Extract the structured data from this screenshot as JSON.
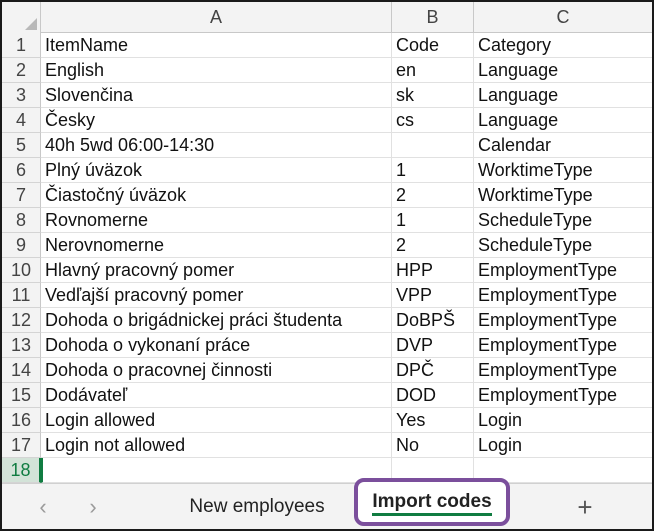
{
  "columns": [
    "A",
    "B",
    "C"
  ],
  "rows": [
    {
      "num": "1",
      "a": "ItemName",
      "b": "Code",
      "c": "Category"
    },
    {
      "num": "2",
      "a": "English",
      "b": "en",
      "c": "Language"
    },
    {
      "num": "3",
      "a": "Slovenčina",
      "b": "sk",
      "c": "Language"
    },
    {
      "num": "4",
      "a": "Česky",
      "b": "cs",
      "c": "Language"
    },
    {
      "num": "5",
      "a": "40h 5wd 06:00-14:30",
      "b": "",
      "c": "Calendar"
    },
    {
      "num": "6",
      "a": "Plný úväzok",
      "b": "1",
      "c": "WorktimeType"
    },
    {
      "num": "7",
      "a": "Čiastočný úväzok",
      "b": "2",
      "c": "WorktimeType"
    },
    {
      "num": "8",
      "a": "Rovnomerne",
      "b": "1",
      "c": "ScheduleType"
    },
    {
      "num": "9",
      "a": "Nerovnomerne",
      "b": "2",
      "c": "ScheduleType"
    },
    {
      "num": "10",
      "a": "Hlavný pracovný pomer",
      "b": "HPP",
      "c": "EmploymentType"
    },
    {
      "num": "11",
      "a": "Vedľajší pracovný pomer",
      "b": "VPP",
      "c": "EmploymentType"
    },
    {
      "num": "12",
      "a": "Dohoda o brigádnickej práci študenta",
      "b": "DoBPŠ",
      "c": "EmploymentType"
    },
    {
      "num": "13",
      "a": "Dohoda o vykonaní práce",
      "b": "DVP",
      "c": "EmploymentType"
    },
    {
      "num": "14",
      "a": "Dohoda o pracovnej činnosti",
      "b": "DPČ",
      "c": "EmploymentType"
    },
    {
      "num": "15",
      "a": "Dodávateľ",
      "b": "DOD",
      "c": "EmploymentType"
    },
    {
      "num": "16",
      "a": "Login allowed",
      "b": "Yes",
      "c": "Login"
    },
    {
      "num": "17",
      "a": "Login not allowed",
      "b": "No",
      "c": "Login"
    },
    {
      "num": "18",
      "a": "",
      "b": "",
      "c": ""
    }
  ],
  "tabs": {
    "prev_icon": "chevron-left-icon",
    "next_icon": "chevron-right-icon",
    "sheets": [
      "New employees",
      "Import codes"
    ],
    "active_sheet": "Import codes",
    "add_icon": "plus-icon"
  },
  "colors": {
    "accent": "#107c41",
    "highlight_border": "#7b4f9c"
  }
}
